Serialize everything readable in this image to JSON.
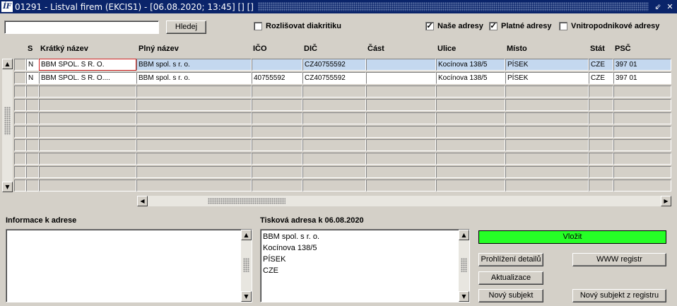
{
  "window": {
    "icon_text": "ÍF",
    "title": "01291 - Listval firem (EKCIS1) - [06.08.2020; 13:45] [] []",
    "btn_restore": "⇙",
    "btn_close": "✕"
  },
  "search": {
    "value": "",
    "button": "Hledej"
  },
  "checkboxes": [
    {
      "label": "Rozlišovat diakritiku",
      "checked": false
    },
    {
      "label": "Naše adresy",
      "checked": true
    },
    {
      "label": "Platné adresy",
      "checked": true
    },
    {
      "label": "Vnitropodnikové adresy",
      "checked": false
    }
  ],
  "table": {
    "headers": [
      "S",
      "Krátký název",
      "Plný název",
      "IČO",
      "DIČ",
      "Část",
      "Ulice",
      "Místo",
      "Stát",
      "PSČ"
    ],
    "rows": [
      [
        "N",
        "BBM SPOL. S R. O.",
        "BBM spol. s r. o.",
        "",
        "CZ40755592",
        "",
        "Kocínova 138/5",
        "PÍSEK",
        "CZE",
        "397 01"
      ],
      [
        "N",
        "BBM SPOL. S R. O....",
        "BBM spol. s r. o.",
        "40755592",
        "CZ40755592",
        "",
        "Kocínova 138/5",
        "PÍSEK",
        "CZE",
        "397 01"
      ]
    ]
  },
  "info": {
    "label": "Informace k adrese",
    "value": ""
  },
  "print_address": {
    "label": "Tisková adresa k 06.08.2020",
    "lines": [
      "BBM spol. s r. o.",
      "Kocínova 138/5",
      "PÍSEK",
      "CZE"
    ]
  },
  "buttons": {
    "insert": "Vložit",
    "detail": "Prohlížení detailů",
    "www": "WWW registr",
    "update": "Aktualizace",
    "new_subject": "Nový subjekt",
    "new_from_registry": "Nový subjekt z registru"
  },
  "colors": {
    "insert_bg": "#26ff26",
    "selected_row": "#c4d8ef",
    "titlebar": "#0a246a"
  }
}
